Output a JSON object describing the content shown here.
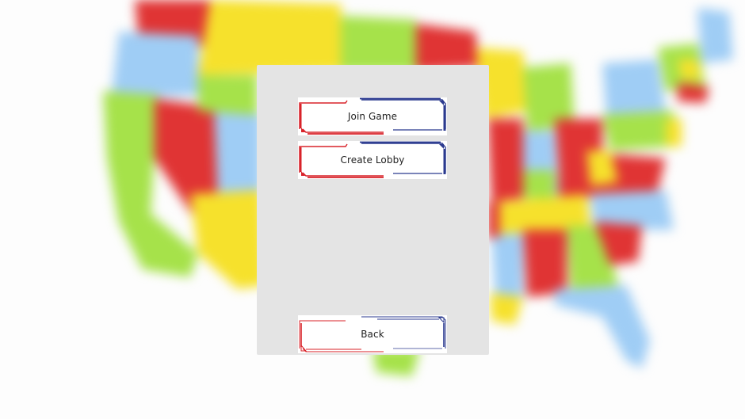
{
  "menu": {
    "join_label": "Join Game",
    "create_label": "Create Lobby",
    "back_label": "Back"
  },
  "colors": {
    "panel": "#e4e4e4",
    "button_face": "#ffffff",
    "accent_red": "#d8232a",
    "accent_blue": "#2b3a8f",
    "state_red": "#e03434",
    "state_yellow": "#f6e12c",
    "state_green": "#a6e24a",
    "state_blue": "#9fcdf5"
  },
  "background": {
    "description_icon": "usa-map-icon"
  }
}
